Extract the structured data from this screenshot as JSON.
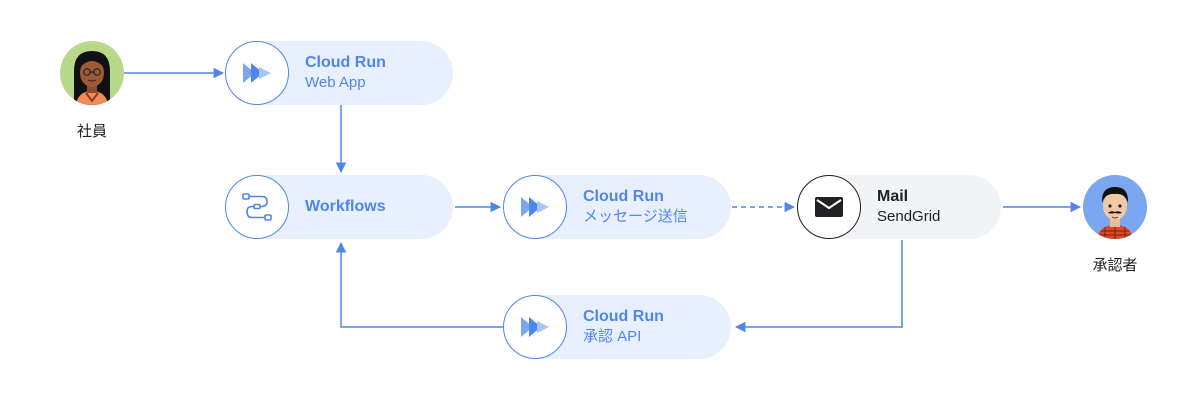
{
  "actors": {
    "employee": {
      "label": "社員",
      "bg_color": "#b9d98a"
    },
    "approver": {
      "label": "承認者",
      "bg_color": "#7aa7f0"
    }
  },
  "nodes": {
    "web_app": {
      "title": "Cloud Run",
      "subtitle": "Web App",
      "icon": "cloud-run-icon"
    },
    "workflows": {
      "title": "Workflows",
      "icon": "workflows-icon"
    },
    "message": {
      "title": "Cloud Run",
      "subtitle": "メッセージ送信",
      "icon": "cloud-run-icon"
    },
    "mail": {
      "title": "Mail",
      "subtitle": "SendGrid",
      "icon": "mail-icon"
    },
    "approval_api": {
      "title": "Cloud Run",
      "subtitle": "承認 API",
      "icon": "cloud-run-icon"
    }
  },
  "colors": {
    "accent": "#4f86ec",
    "node_bg": "#e8f0fd",
    "mail_bg": "#f1f3f4",
    "text_dark": "#202124"
  }
}
